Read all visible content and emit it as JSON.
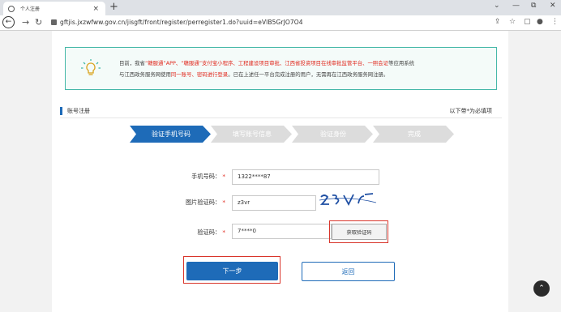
{
  "browser": {
    "tab_title": "个人注册",
    "tab_close": "×",
    "new_tab": "+",
    "url": "gftjis.jxzwfww.gov.cn/jisgft/front/register/perregister1.do?uuid=eVlB5GrJO7O4",
    "window_controls": [
      "⌄",
      "—",
      "⧉",
      "✕"
    ]
  },
  "notice": {
    "line1_pre": "目前，我省",
    "line1_red1": "“赣服通”APP、“赣服通”支付宝小程序、工程建设项目审批、江西省投资项目在线审批监管平台、一照会证",
    "line1_post": "等应用系统",
    "line2_pre": "与江西政务服务网使用",
    "line2_red": "同一账号、密码进行登录",
    "line2_post": "。已在上述任一平台完成注册的用户，无需再在江西政务服务网注册。"
  },
  "section": {
    "title": "账号注册",
    "required_hint": "以下带*为必填项"
  },
  "steps": [
    {
      "label": "验证手机号码",
      "active": true
    },
    {
      "label": "填写账号信息",
      "active": false
    },
    {
      "label": "验证身份",
      "active": false
    },
    {
      "label": "完成",
      "active": false
    }
  ],
  "form": {
    "phone_label": "手机号码：",
    "phone_value": "1322****87",
    "img_code_label": "图片验证码：",
    "img_code_value": "z3vr",
    "captcha_text": "Z3Vr",
    "sms_label": "验证码：",
    "sms_value": "7****0",
    "star": "*",
    "get_code_button": "获取验证码"
  },
  "buttons": {
    "next": "下一步",
    "back": "返回"
  },
  "colors": {
    "accent": "#1e6bb8",
    "highlight": "#d9352b",
    "notice_border": "#46b8a8"
  }
}
